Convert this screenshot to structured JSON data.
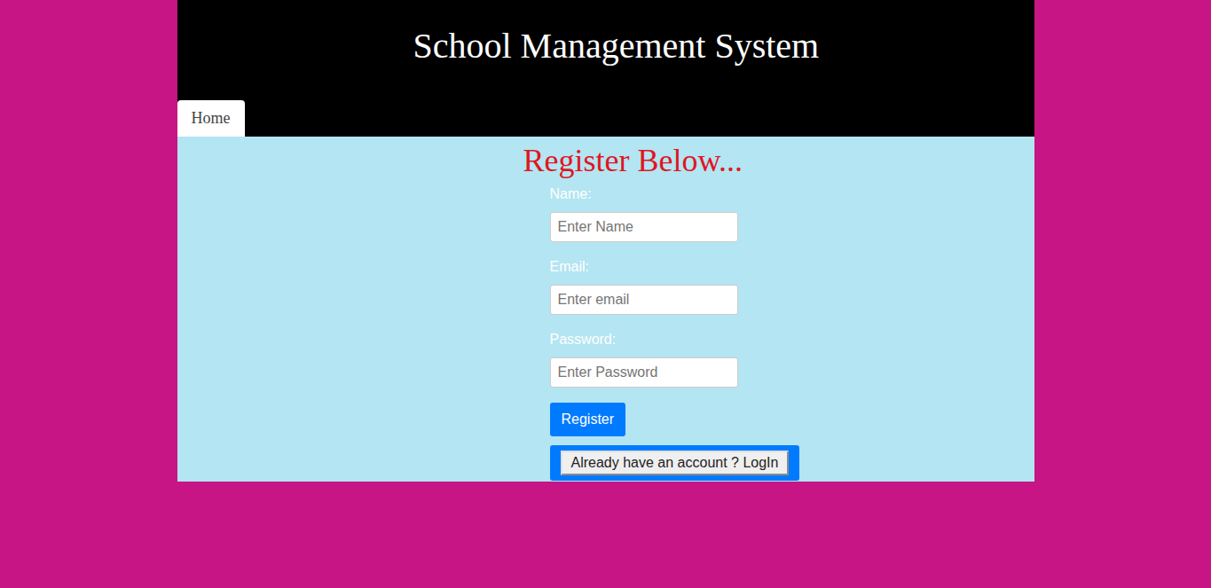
{
  "header": {
    "title": "School Management System"
  },
  "nav": [
    {
      "label": "Home",
      "selected": true
    }
  ],
  "form": {
    "heading": "Register Below...",
    "fields": [
      {
        "label": "Name:",
        "placeholder": "Enter Name",
        "kind": "text"
      },
      {
        "label": "Email:",
        "placeholder": "Enter email",
        "kind": "email"
      },
      {
        "label": "Password:",
        "placeholder": "Enter Password",
        "kind": "password"
      }
    ],
    "submit": "Register",
    "login": "Already have an account ? LogIn"
  }
}
